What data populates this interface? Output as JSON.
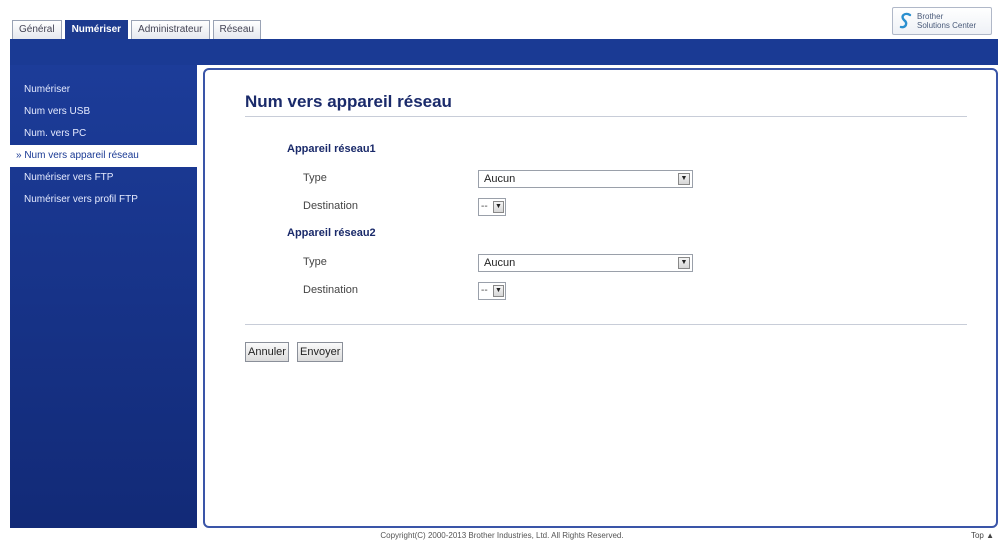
{
  "tabs": [
    {
      "label": "Général"
    },
    {
      "label": "Numériser"
    },
    {
      "label": "Administrateur"
    },
    {
      "label": "Réseau"
    }
  ],
  "logo": {
    "line1": "Brother",
    "line2": "Solutions Center"
  },
  "sidebar": {
    "items": [
      {
        "label": "Numériser"
      },
      {
        "label": "Num vers USB"
      },
      {
        "label": "Num. vers PC"
      },
      {
        "label": "» Num vers appareil réseau"
      },
      {
        "label": "Numériser vers FTP"
      },
      {
        "label": "Numériser vers profil FTP"
      }
    ]
  },
  "main": {
    "title": "Num vers appareil réseau",
    "groups": [
      {
        "title": "Appareil réseau1",
        "type_label": "Type",
        "type_value": "Aucun",
        "dest_label": "Destination",
        "dest_value": "--"
      },
      {
        "title": "Appareil réseau2",
        "type_label": "Type",
        "type_value": "Aucun",
        "dest_label": "Destination",
        "dest_value": "--"
      }
    ],
    "cancel_label": "Annuler",
    "submit_label": "Envoyer"
  },
  "footer": {
    "copyright": "Copyright(C) 2000-2013 Brother Industries, Ltd. All Rights Reserved.",
    "top_link": "Top ▲"
  },
  "colors": {
    "accent": "#1a3a94",
    "sidebar": "#1c3c99"
  },
  "icons": {
    "dropdown": "chevron-down-icon",
    "logo": "brother-s-icon"
  }
}
